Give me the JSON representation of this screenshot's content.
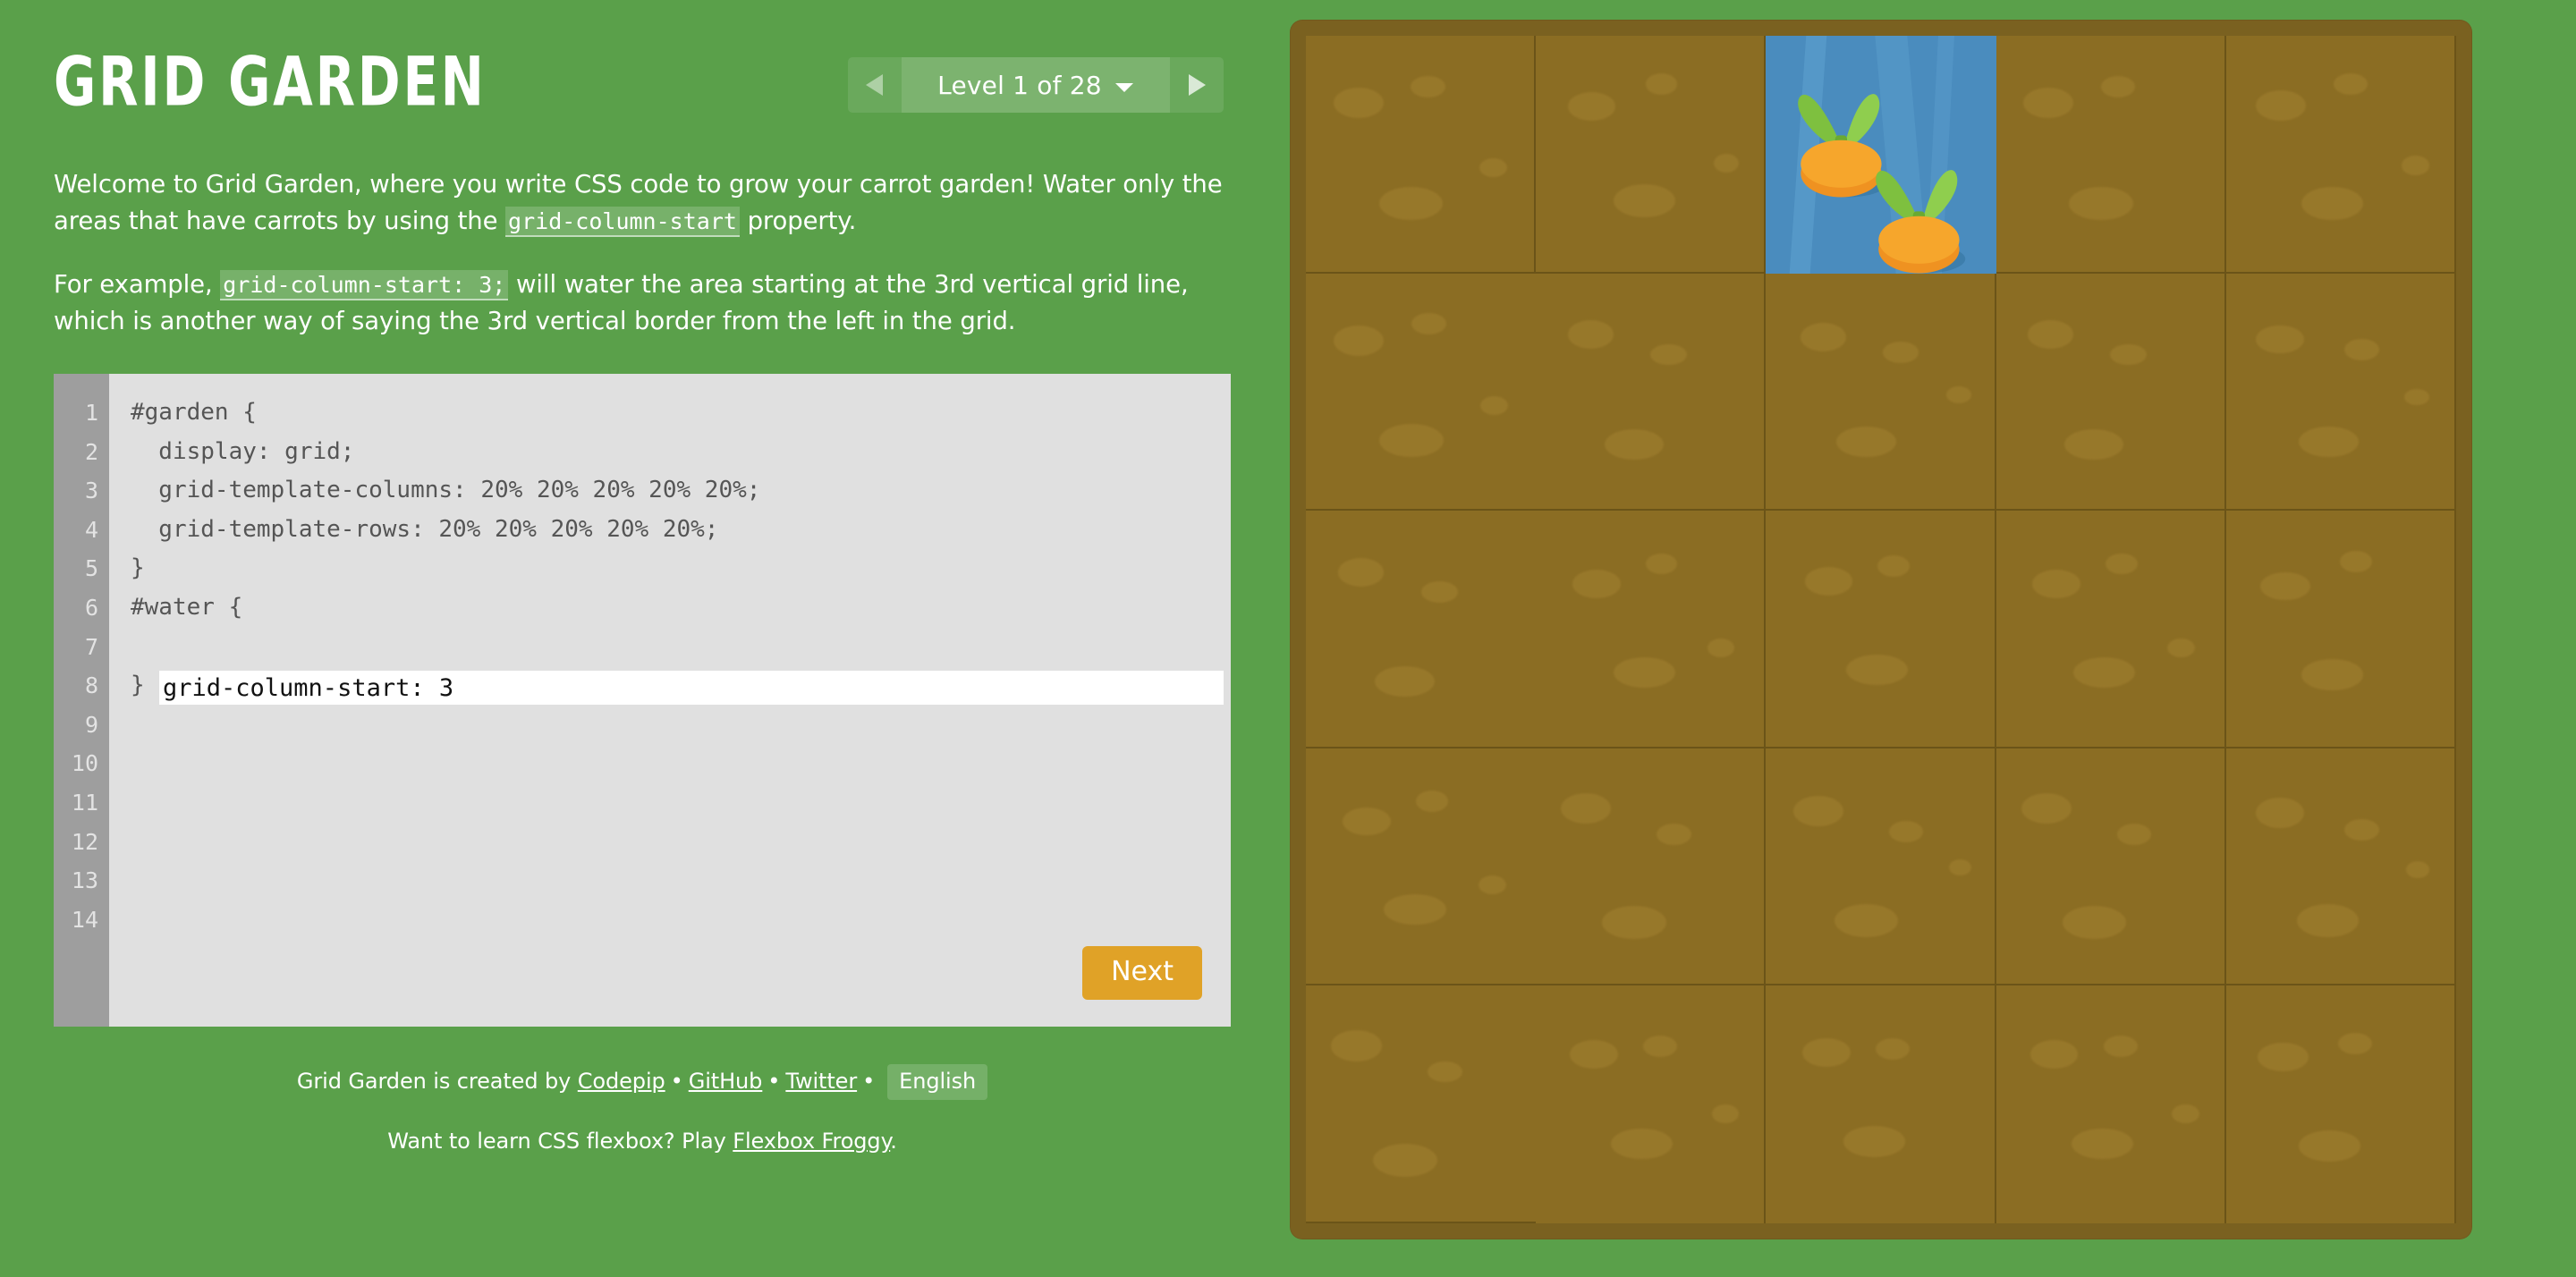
{
  "app": {
    "title": "GRID GARDEN",
    "background_color": "#5aa04a"
  },
  "level_selector": {
    "prev_label": "prev-level",
    "next_label": "next-level",
    "display": "Level 1 of 28",
    "level_current": 1,
    "level_total": 28,
    "caret": "chevron-down"
  },
  "instructions": {
    "p1_before": "Welcome to Grid Garden, where you write CSS code to grow your carrot garden! Water only the areas that have carrots by using the ",
    "p1_code": "grid-column-start",
    "p1_after": " property.",
    "p2_before": "For example, ",
    "p2_code": "grid-column-start: 3;",
    "p2_after": " will water the area starting at the 3rd vertical grid line, which is another way of saying the 3rd vertical border from the left in the grid."
  },
  "editor": {
    "line_numbers": [
      "1",
      "2",
      "3",
      "4",
      "5",
      "6",
      "7",
      "8",
      "9",
      "10",
      "11",
      "12",
      "13",
      "14"
    ],
    "lines_before": [
      "#garden {",
      "  display: grid;",
      "  grid-template-columns: 20% 20% 20% 20% 20%;",
      "  grid-template-rows: 20% 20% 20% 20% 20%;",
      "}",
      "",
      "#water {"
    ],
    "input_value": "grid-column-start: 3",
    "input_placeholder": "",
    "lines_after": [
      "}"
    ],
    "next_button_label": "Next",
    "next_button_color": "#e0a227",
    "background_color": "#e0e0e0",
    "gutter_color": "#9e9e9e"
  },
  "footer": {
    "created_by_prefix": "Grid Garden is created by ",
    "codepip": "Codepip",
    "github": "GitHub",
    "twitter": "Twitter",
    "separator": "•",
    "language": "English",
    "flexbox_prefix": "Want to learn CSS flexbox? Play ",
    "flexbox_link": "Flexbox Froggy",
    "flexbox_suffix": "."
  },
  "garden": {
    "columns": 5,
    "rows": 5,
    "dirt_color": "#8b6d23",
    "frame_color": "#7a6120",
    "water_color": "#4a8cbe",
    "carrot_color": "#f5a623",
    "leaf_color": "#7ec03f",
    "water_cell": {
      "column_start": 3,
      "column_end": 4,
      "row_start": 1,
      "row_end": 2
    },
    "carrot_cells": [
      {
        "row": 1,
        "column": 3
      }
    ],
    "carrot_count": 2
  }
}
